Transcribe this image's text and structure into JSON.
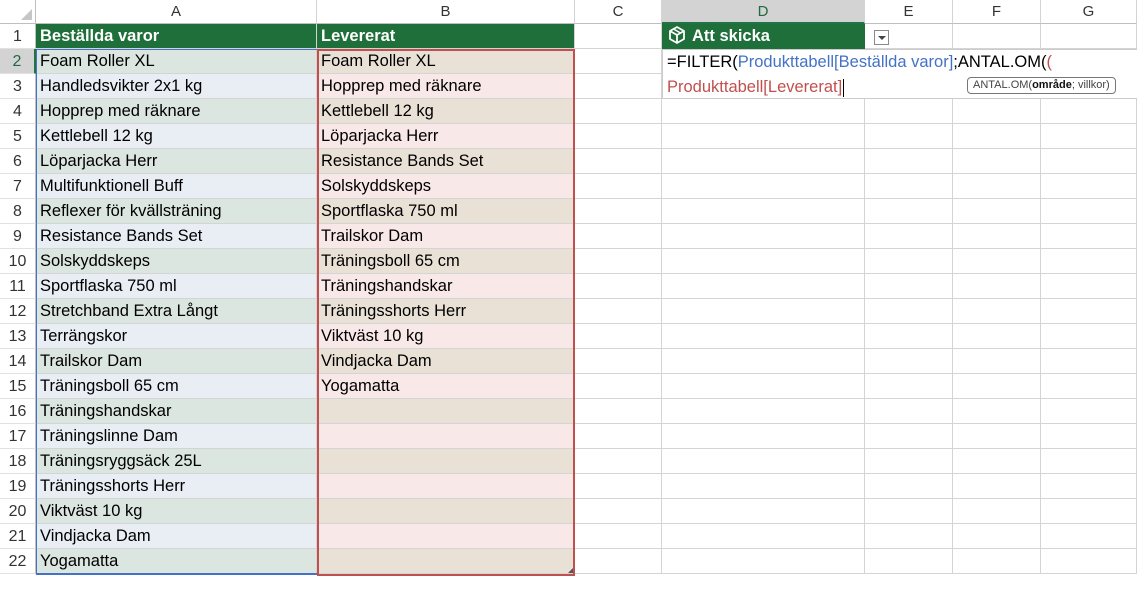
{
  "columns": [
    "A",
    "B",
    "C",
    "D",
    "E",
    "F",
    "G"
  ],
  "selected_column": "D",
  "rows": [
    "1",
    "2",
    "3",
    "4",
    "5",
    "6",
    "7",
    "8",
    "9",
    "10",
    "11",
    "12",
    "13",
    "14",
    "15",
    "16",
    "17",
    "18",
    "19",
    "20",
    "21",
    "22"
  ],
  "selected_row": "2",
  "table": {
    "header_a": "Beställda varor",
    "header_b": "Levererat",
    "col_a": [
      "Foam Roller XL",
      "Handledsvikter 2x1 kg",
      "Hopprep med räknare",
      "Kettlebell 12 kg",
      "Löparjacka Herr",
      "Multifunktionell Buff",
      "Reflexer för kvällsträning",
      "Resistance Bands Set",
      "Solskyddskeps",
      "Sportflaska 750 ml",
      "Stretchband Extra Långt",
      "Terrängskor",
      "Trailskor Dam",
      "Träningsboll 65 cm",
      "Träningshandskar",
      "Träningslinne Dam",
      "Träningsryggsäck 25L",
      "Träningsshorts Herr",
      "Viktväst 10 kg",
      "Vindjacka Dam",
      "Yogamatta"
    ],
    "col_b": [
      "Foam Roller XL",
      "Hopprep med räknare",
      "Kettlebell 12 kg",
      "Löparjacka Herr",
      "Resistance Bands Set",
      "Solskyddskeps",
      "Sportflaska 750 ml",
      "Trailskor Dam",
      "Träningsboll 65 cm",
      "Träningshandskar",
      "Träningsshorts Herr",
      "Viktväst 10 kg",
      "Vindjacka Dam",
      "Yogamatta",
      "",
      "",
      "",
      "",
      "",
      "",
      ""
    ]
  },
  "d_header": "Att skicka",
  "formula": {
    "part1": "=FILTER(",
    "ref1": "Produkttabell[Beställda varor]",
    "part2": ";ANTAL.OM(",
    "open_paren": "(",
    "ref2": "Produkttabell[Levererat]"
  },
  "tooltip": {
    "fn": "ANTAL.OM(",
    "arg_bold": "område",
    "rest": "; villkor)"
  },
  "colors": {
    "table_header": "#1f6f3a",
    "ref_blue": "#4472c4",
    "ref_red": "#c0504d"
  }
}
